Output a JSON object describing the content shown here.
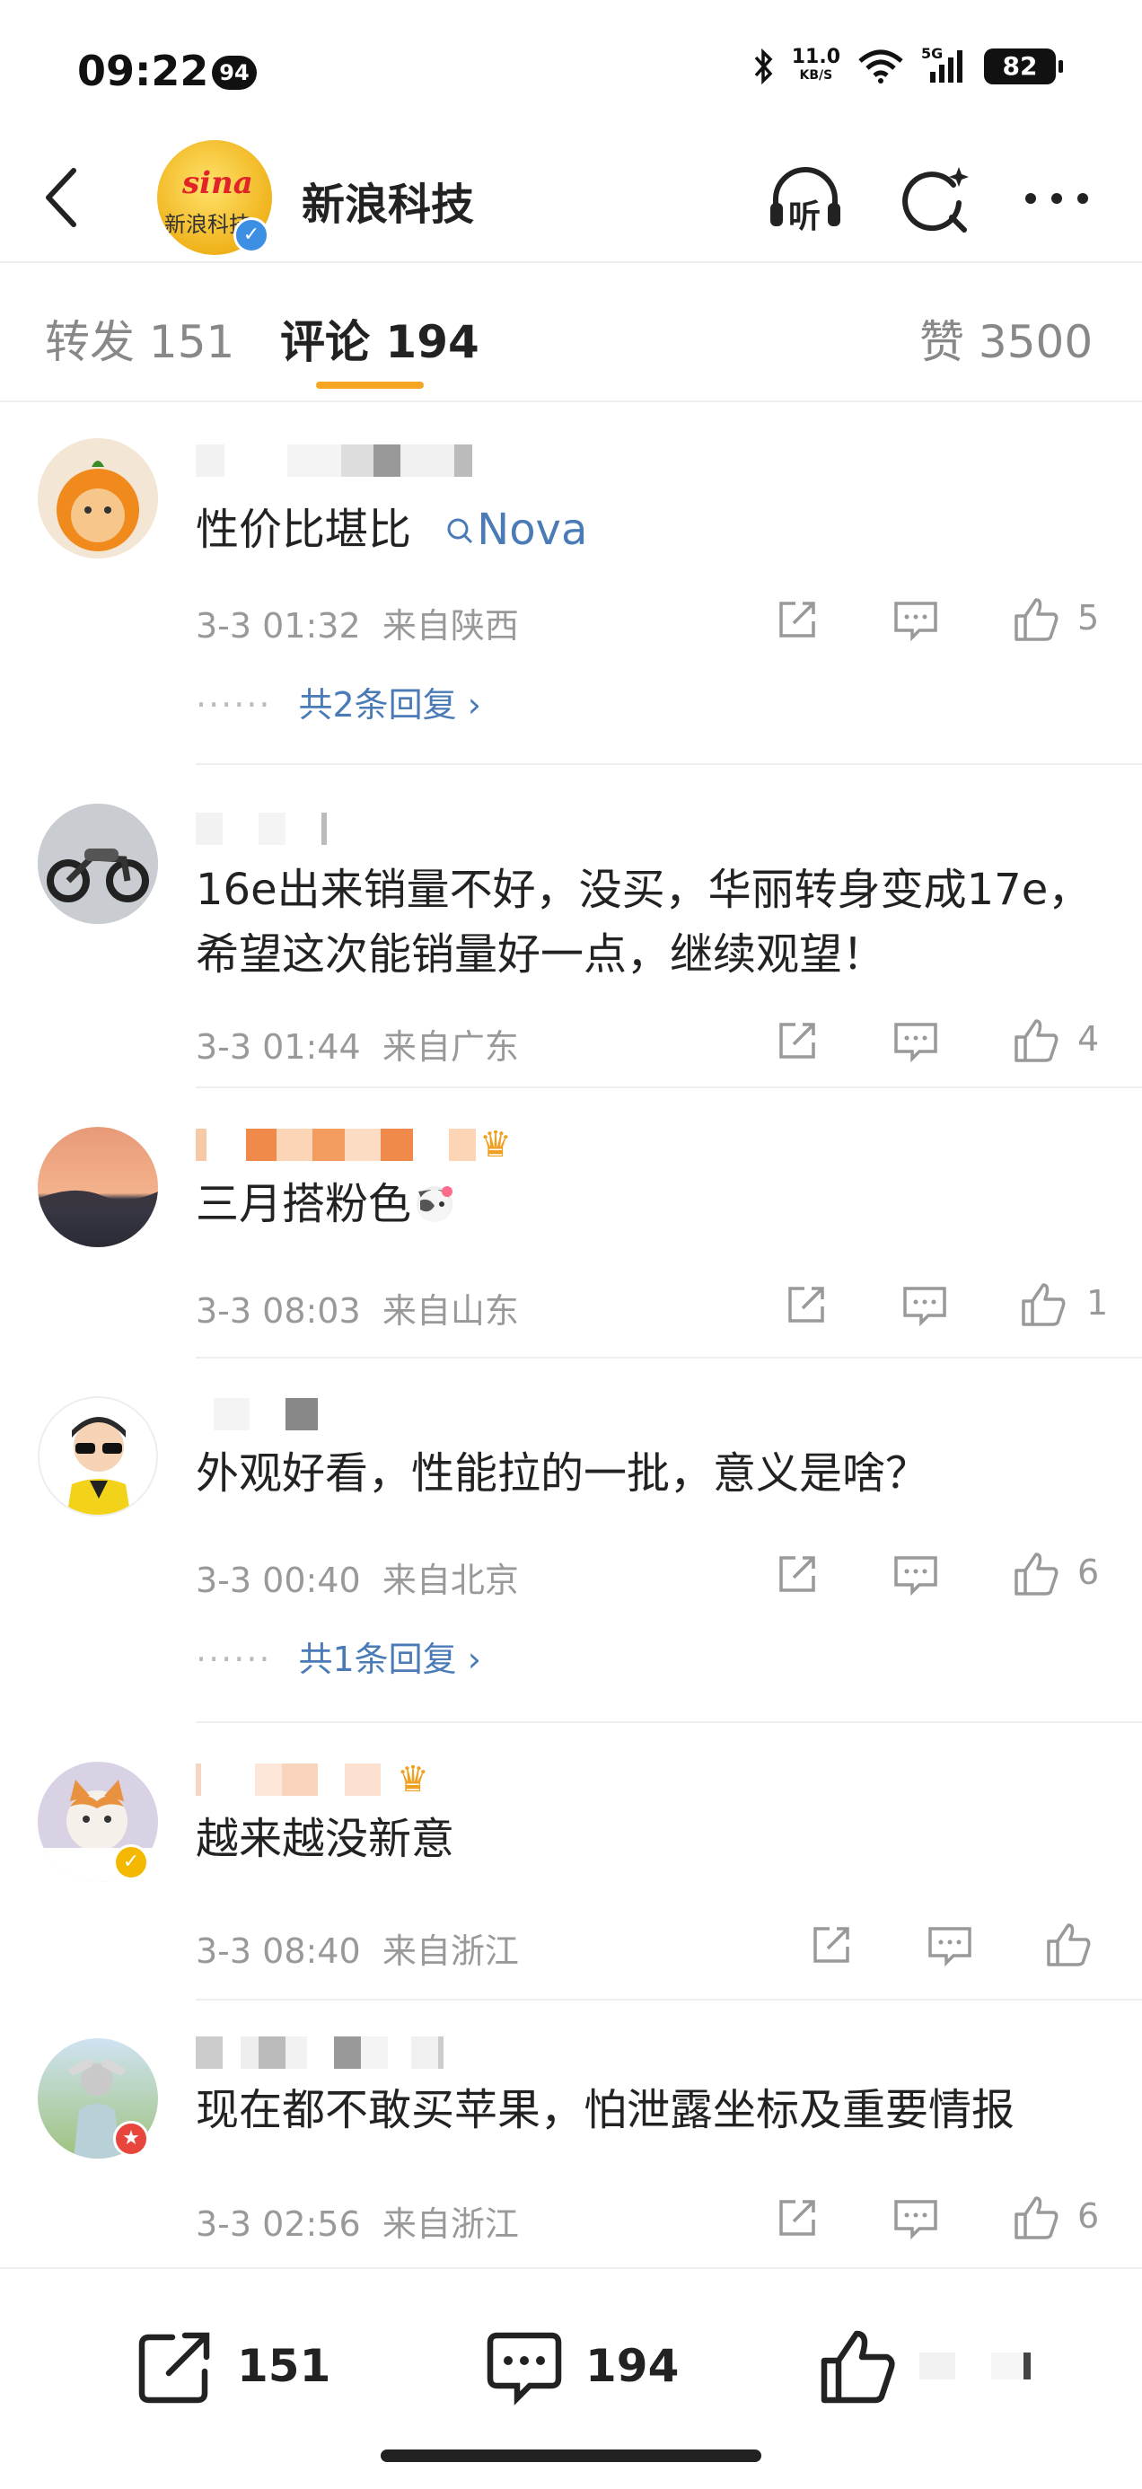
{
  "status_bar": {
    "time": "09:22",
    "notification_count": "94",
    "net_speed_value": "11.0",
    "net_speed_unit": "KB/S",
    "network": "5G",
    "battery": "82"
  },
  "header": {
    "page_name": "新浪科技",
    "avatar_text_top": "sina",
    "avatar_text_bottom": "新浪科技",
    "icons": [
      "back-icon",
      "listen-icon",
      "search-icon",
      "more-icon"
    ],
    "listen_label": "听"
  },
  "tabs": [
    {
      "label": "转发 151"
    },
    {
      "label": "评论 194"
    },
    {
      "label": "赞 3500"
    }
  ],
  "comments": [
    {
      "text": "性价比堪比",
      "tag": "Nova",
      "time": "3-3 01:32",
      "location": "来自陕西",
      "likes": "5",
      "replies": "共2条回复"
    },
    {
      "text": "16e出来销量不好，没买，华丽转身变成17e，希望这次能销量好一点，继续观望！",
      "time": "3-3 01:44",
      "location": "来自广东",
      "likes": "4"
    },
    {
      "text": "三月搭粉色",
      "time": "3-3 08:03",
      "location": "来自山东",
      "likes": "1"
    },
    {
      "text": "外观好看，性能拉的一批，意义是啥？",
      "time": "3-3 00:40",
      "location": "来自北京",
      "likes": "6",
      "replies": "共1条回复"
    },
    {
      "text": "越来越没新意",
      "time": "3-3 08:40",
      "location": "来自浙江",
      "likes": ""
    },
    {
      "text": "现在都不敢买苹果，怕泄露坐标及重要情报",
      "time": "3-3 02:56",
      "location": "来自浙江",
      "likes": "6"
    }
  ],
  "bottom_bar": {
    "repost_count": "151",
    "comment_count": "194"
  },
  "colors": {
    "accent_underline": "#f6a623",
    "link_blue": "#4a7bb7",
    "meta_gray": "#999999"
  }
}
